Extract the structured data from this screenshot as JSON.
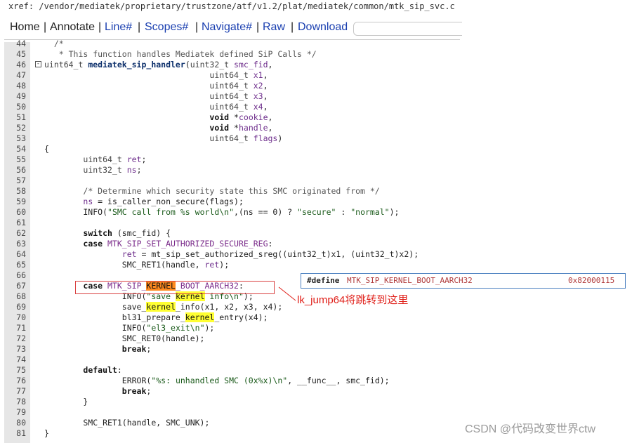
{
  "xref_path": "xref: /vendor/mediatek/proprietary/trustzone/atf/v1.2/plat/mediatek/common/mtk_sip_svc.c",
  "nav": {
    "separator": "|",
    "items": [
      "Home",
      "Annotate",
      "Line#",
      "Scopes#",
      "Navigate#",
      "Raw",
      "Download"
    ],
    "search_value": ""
  },
  "colors": {
    "link": "#1a3fb0",
    "highlight": "#ffff33",
    "highlight_active": "#ff8a1e",
    "annotation": "#e0201a",
    "tooltip_border": "#4a7fc0"
  },
  "code_lines": [
    {
      "n": "44",
      "t": [
        [
          "  /*",
          "cm"
        ]
      ]
    },
    {
      "n": "45",
      "t": [
        [
          "   * This function handles Mediatek defined SiP Calls */",
          "cm"
        ]
      ]
    },
    {
      "n": "46",
      "fold": true,
      "t": [
        [
          "uint64_t ",
          "ty"
        ],
        [
          "mediatek_sip_handler",
          "fn"
        ],
        [
          "(",
          ""
        ],
        [
          "uint32_t ",
          "ty"
        ],
        [
          "smc_fid",
          "vr"
        ],
        [
          ",",
          ""
        ]
      ]
    },
    {
      "n": "47",
      "t": [
        [
          "                                  ",
          ""
        ],
        [
          "uint64_t ",
          "ty"
        ],
        [
          "x1",
          "vr"
        ],
        [
          ",",
          ""
        ]
      ]
    },
    {
      "n": "48",
      "t": [
        [
          "                                  ",
          ""
        ],
        [
          "uint64_t ",
          "ty"
        ],
        [
          "x2",
          "vr"
        ],
        [
          ",",
          ""
        ]
      ]
    },
    {
      "n": "49",
      "t": [
        [
          "                                  ",
          ""
        ],
        [
          "uint64_t ",
          "ty"
        ],
        [
          "x3",
          "vr"
        ],
        [
          ",",
          ""
        ]
      ]
    },
    {
      "n": "50",
      "t": [
        [
          "                                  ",
          ""
        ],
        [
          "uint64_t ",
          "ty"
        ],
        [
          "x4",
          "vr"
        ],
        [
          ",",
          ""
        ]
      ]
    },
    {
      "n": "51",
      "t": [
        [
          "                                  ",
          ""
        ],
        [
          "void ",
          "kw"
        ],
        [
          "*",
          ""
        ],
        [
          "cookie",
          "vr"
        ],
        [
          ",",
          ""
        ]
      ]
    },
    {
      "n": "52",
      "t": [
        [
          "                                  ",
          ""
        ],
        [
          "void ",
          "kw"
        ],
        [
          "*",
          ""
        ],
        [
          "handle",
          "vr"
        ],
        [
          ",",
          ""
        ]
      ]
    },
    {
      "n": "53",
      "t": [
        [
          "                                  ",
          ""
        ],
        [
          "uint64_t ",
          "ty"
        ],
        [
          "flags",
          "vr"
        ],
        [
          ")",
          ""
        ]
      ]
    },
    {
      "n": "54",
      "t": [
        [
          "{",
          ""
        ]
      ]
    },
    {
      "n": "55",
      "t": [
        [
          "        ",
          ""
        ],
        [
          "uint64_t ",
          "ty"
        ],
        [
          "ret",
          "vr"
        ],
        [
          ";",
          ""
        ]
      ]
    },
    {
      "n": "56",
      "t": [
        [
          "        ",
          ""
        ],
        [
          "uint32_t ",
          "ty"
        ],
        [
          "ns",
          "vr"
        ],
        [
          ";",
          ""
        ]
      ]
    },
    {
      "n": "57",
      "t": [
        [
          "",
          ""
        ]
      ]
    },
    {
      "n": "58",
      "t": [
        [
          "        ",
          ""
        ],
        [
          "/* Determine which security state this SMC originated from */",
          "cm"
        ]
      ]
    },
    {
      "n": "59",
      "t": [
        [
          "        ",
          ""
        ],
        [
          "ns",
          "vr"
        ],
        [
          " = is_caller_non_secure(flags);",
          ""
        ]
      ]
    },
    {
      "n": "60",
      "t": [
        [
          "        INFO(",
          ""
        ],
        [
          "\"SMC call from %s world\\n\"",
          "st"
        ],
        [
          ",(ns == 0) ? ",
          ""
        ],
        [
          "\"secure\"",
          "st"
        ],
        [
          " : ",
          ""
        ],
        [
          "\"normal\"",
          "st"
        ],
        [
          ");",
          ""
        ]
      ]
    },
    {
      "n": "61",
      "t": [
        [
          "",
          ""
        ]
      ]
    },
    {
      "n": "62",
      "t": [
        [
          "        ",
          ""
        ],
        [
          "switch",
          "kw"
        ],
        [
          " (smc_fid) {",
          ""
        ]
      ]
    },
    {
      "n": "63",
      "t": [
        [
          "        ",
          ""
        ],
        [
          "case",
          "kw"
        ],
        [
          " ",
          ""
        ],
        [
          "MTK_SIP_SET_AUTHORIZED_SECURE_REG",
          "ma"
        ],
        [
          ":",
          ""
        ]
      ]
    },
    {
      "n": "64",
      "t": [
        [
          "                ",
          ""
        ],
        [
          "ret",
          "vr"
        ],
        [
          " = mt_sip_set_authorized_sreg((uint32_t)x1, (uint32_t)x2);",
          ""
        ]
      ]
    },
    {
      "n": "65",
      "t": [
        [
          "                SMC_RET1(handle, ",
          ""
        ],
        [
          "ret",
          "vr"
        ],
        [
          ");",
          ""
        ]
      ]
    },
    {
      "n": "66",
      "t": [
        [
          "",
          ""
        ]
      ]
    },
    {
      "n": "67",
      "t": [
        [
          "        ",
          ""
        ],
        [
          "case",
          "kw"
        ],
        [
          " ",
          ""
        ],
        [
          "MTK_SIP_",
          "ma"
        ],
        [
          "KERNEL",
          "hl2"
        ],
        [
          "_BOOT_AARCH32",
          "ma"
        ],
        [
          ":",
          ""
        ]
      ]
    },
    {
      "n": "68",
      "t": [
        [
          "                INFO(",
          ""
        ],
        [
          "\"save ",
          "st"
        ],
        [
          "kernel",
          "hl"
        ],
        [
          " info\\n\"",
          "st"
        ],
        [
          ");",
          ""
        ]
      ]
    },
    {
      "n": "69",
      "t": [
        [
          "                save_",
          ""
        ],
        [
          "kernel",
          "hl"
        ],
        [
          "_info(x1, x2, x3, x4);",
          ""
        ]
      ]
    },
    {
      "n": "70",
      "t": [
        [
          "                bl31_prepare_",
          ""
        ],
        [
          "kernel",
          "hl"
        ],
        [
          "_entry(x4);",
          ""
        ]
      ]
    },
    {
      "n": "71",
      "t": [
        [
          "                INFO(",
          ""
        ],
        [
          "\"el3_exit\\n\"",
          "st"
        ],
        [
          ");",
          ""
        ]
      ]
    },
    {
      "n": "72",
      "t": [
        [
          "                SMC_RET0(handle);",
          ""
        ]
      ]
    },
    {
      "n": "73",
      "t": [
        [
          "                ",
          ""
        ],
        [
          "break",
          "kw"
        ],
        [
          ";",
          ""
        ]
      ]
    },
    {
      "n": "74",
      "t": [
        [
          "",
          ""
        ]
      ]
    },
    {
      "n": "75",
      "t": [
        [
          "        ",
          ""
        ],
        [
          "default",
          "kw"
        ],
        [
          ":",
          ""
        ]
      ]
    },
    {
      "n": "76",
      "t": [
        [
          "                ERROR(",
          ""
        ],
        [
          "\"%s: unhandled SMC (0x%x)\\n\"",
          "st"
        ],
        [
          ", __func__, smc_fid);",
          ""
        ]
      ]
    },
    {
      "n": "77",
      "t": [
        [
          "                ",
          ""
        ],
        [
          "break",
          "kw"
        ],
        [
          ";",
          ""
        ]
      ]
    },
    {
      "n": "78",
      "t": [
        [
          "        }",
          ""
        ]
      ]
    },
    {
      "n": "79",
      "t": [
        [
          "",
          ""
        ]
      ]
    },
    {
      "n": "80",
      "t": [
        [
          "        SMC_RET1(handle, SMC_UNK);",
          ""
        ]
      ]
    },
    {
      "n": "81",
      "t": [
        [
          "}",
          ""
        ]
      ]
    }
  ],
  "tooltip": {
    "keyword": "#define",
    "name": "MTK_SIP_KERNEL_BOOT_AARCH32",
    "value": "0x82000115"
  },
  "annotation": "lk_jump64将跳转到这里",
  "watermark": "CSDN @代码改变世界ctw"
}
